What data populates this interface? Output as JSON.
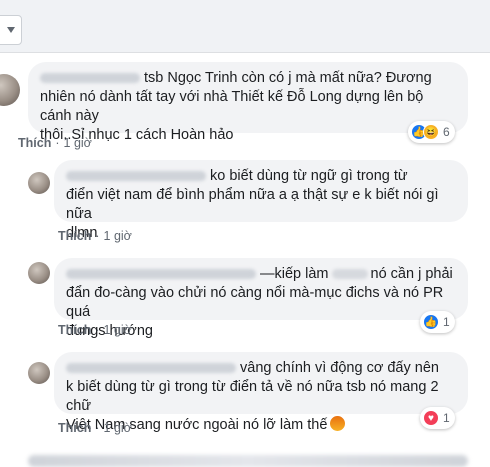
{
  "comments": [
    {
      "line1": "tsb Ngọc Trinh còn có j mà mất nữa? Đương",
      "line2": "nhiên nó dành tất tay với nhà Thiết kế Đỗ Long dựng lên bộ cánh này",
      "line3": "thôi..Sỉ nhục 1 cách Hoàn hảo",
      "like_label": "Thích",
      "time": "1 giờ",
      "reaction_count": "6",
      "reactions": [
        "like-icon",
        "haha-icon"
      ]
    },
    {
      "line1": "ko biết dùng từ ngữ gì trong từ",
      "line2": "điển việt nam để bình phẩm nữa a ạ thật sự e k biết nói gì nữa",
      "line3": "dlmn",
      "like_label": "Thích",
      "time": "1 giờ"
    },
    {
      "line1a": "—kiếp làm",
      "line1b": "nó cần j phải",
      "line2": "đẩn đo-càng vào chửi nó càng nổi mà-mục đichs và nó PR quá",
      "line3": "đungs hướng",
      "like_label": "Thích",
      "time": "1 giờ",
      "reaction_count": "1",
      "reactions": [
        "like-icon"
      ]
    },
    {
      "line1": "vâng chính vì động cơ đấy nên",
      "line2": "k biết dùng từ gì trong từ điển tả về nó nữa tsb nó mang 2 chữ",
      "line3": "Việt Nam sang nước ngoài nó lỡ làm thế",
      "like_label": "Thích",
      "time": "1 giờ",
      "reaction_count": "1",
      "reactions": [
        "love-icon"
      ]
    }
  ],
  "colors": {
    "bubble": "#f2f3f5",
    "link": "#606770",
    "like_blue": "#1877f2",
    "love_red": "#f33e58"
  }
}
